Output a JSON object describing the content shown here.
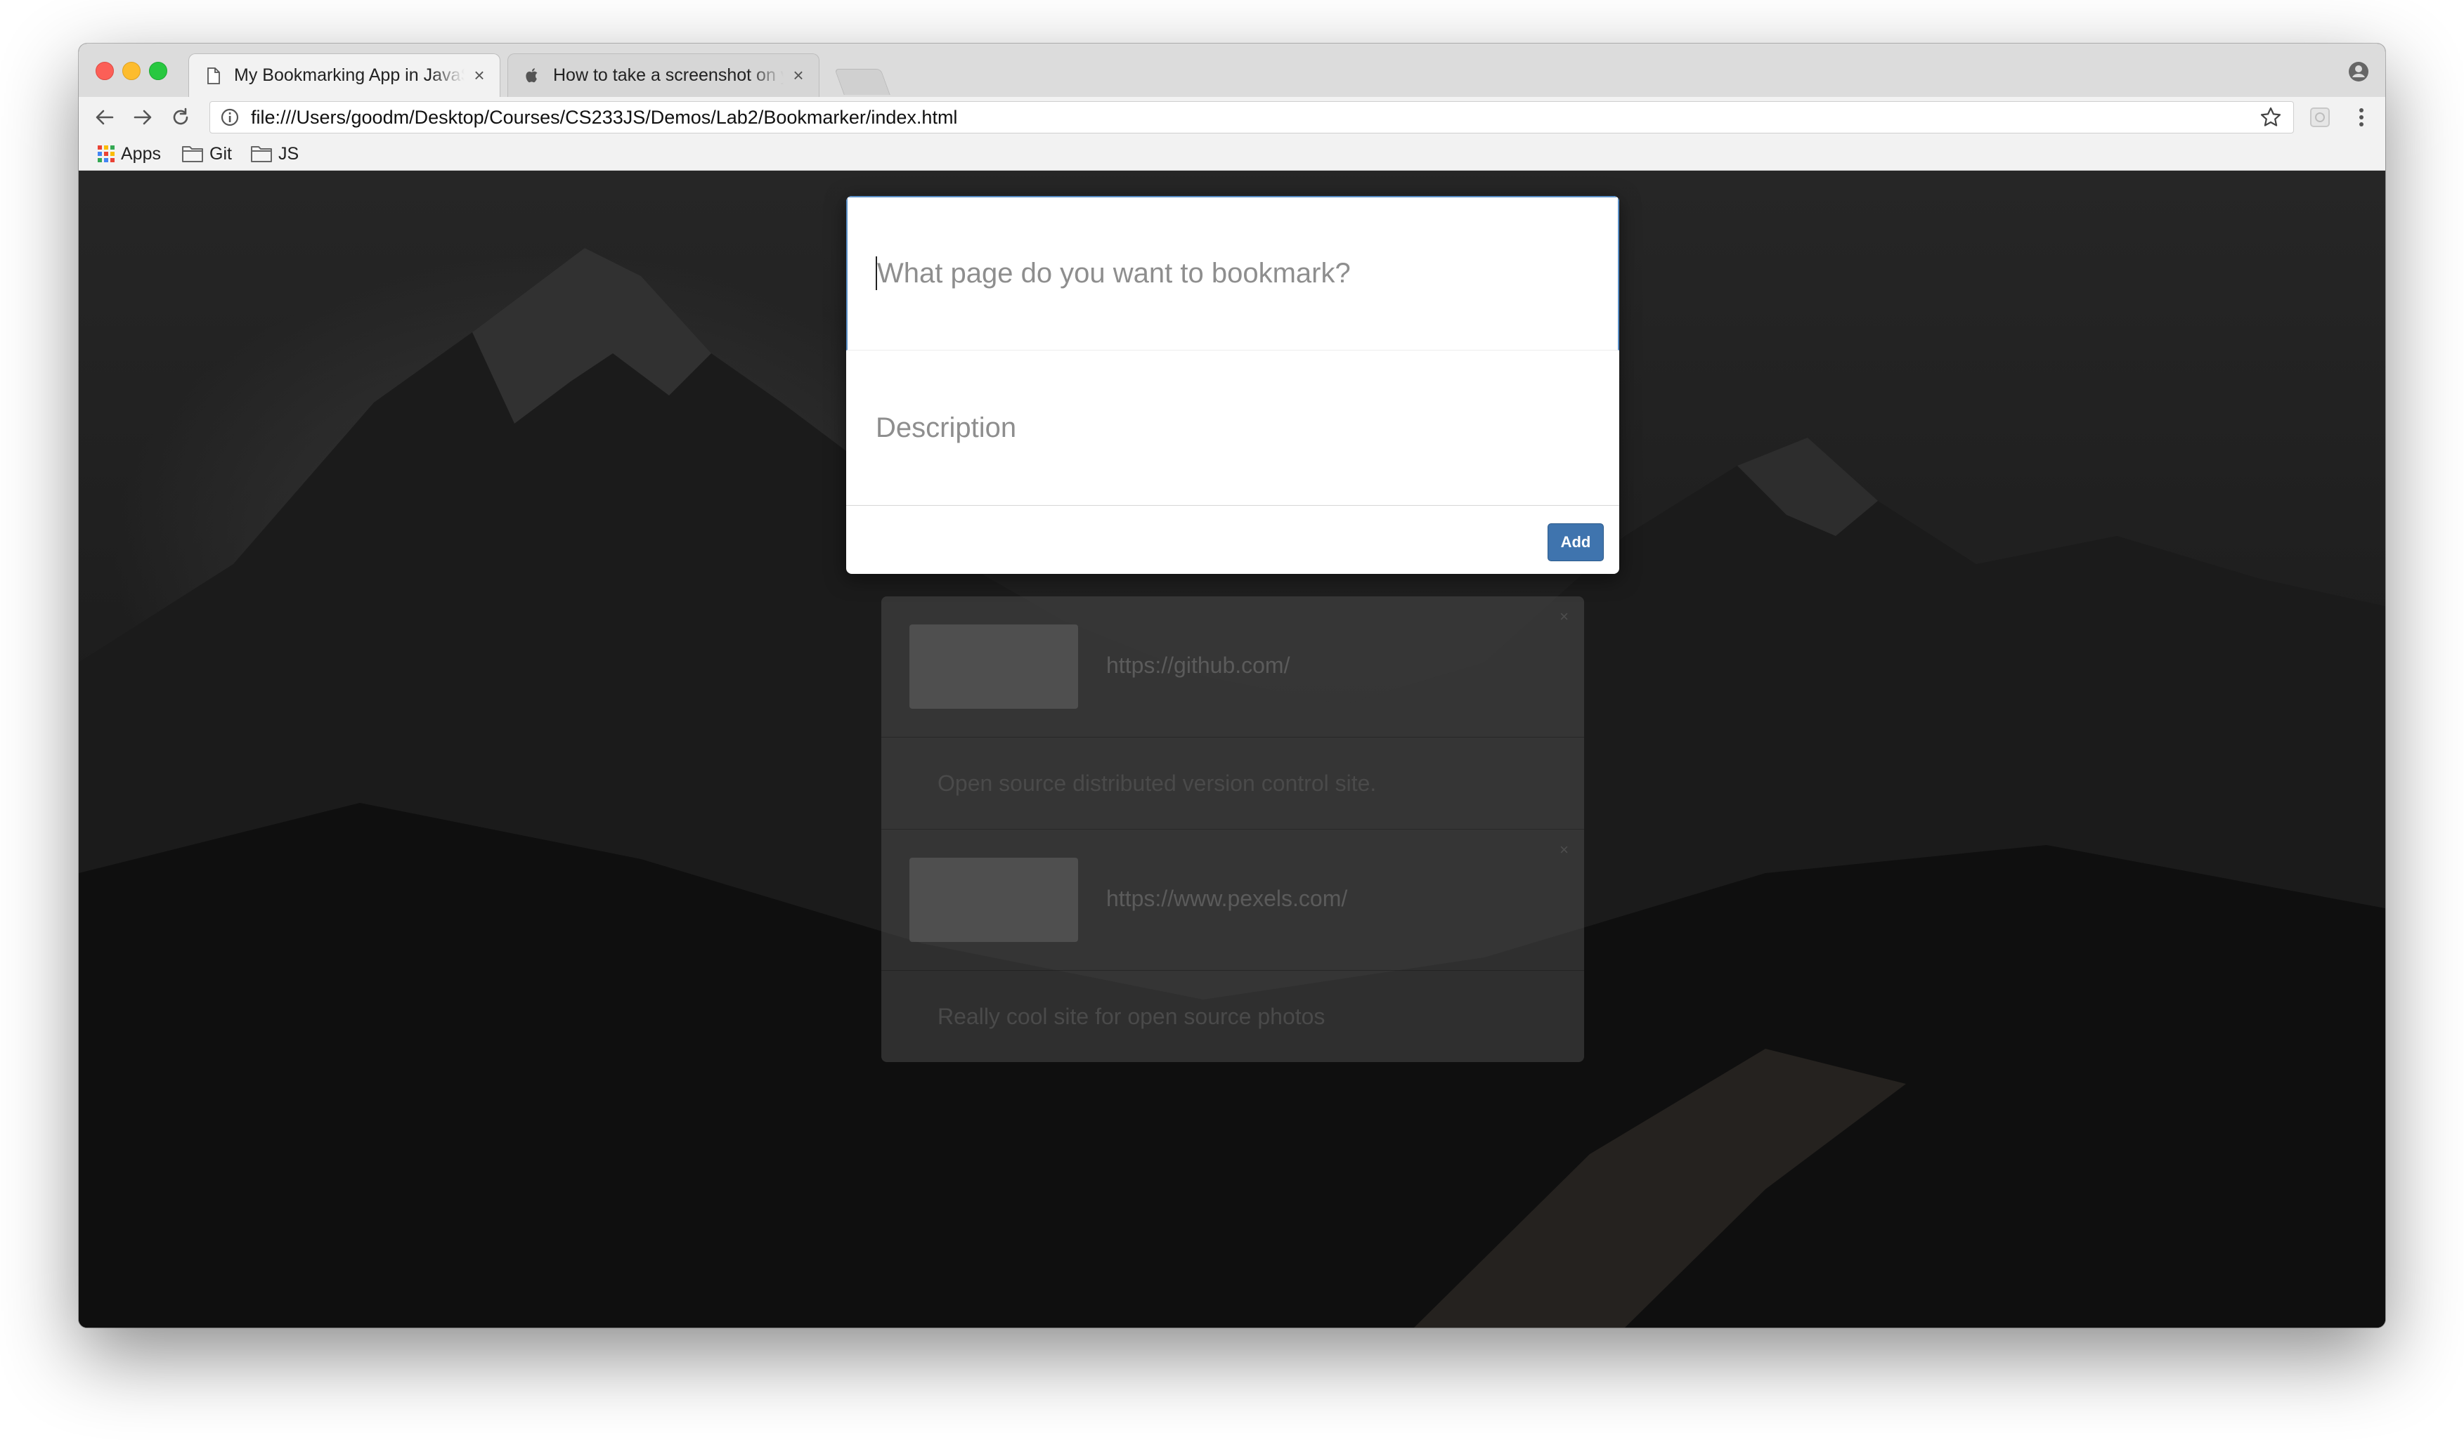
{
  "browser": {
    "tabs": [
      {
        "title": "My Bookmarking App in JavaScript",
        "close": "×"
      },
      {
        "title": "How to take a screenshot on your Mac",
        "close": "×"
      }
    ],
    "url": "file:///Users/goodm/Desktop/Courses/CS233JS/Demos/Lab2/Bookmarker/index.html",
    "bookmarks": [
      {
        "label": "Apps",
        "icon": "apps-grid-icon"
      },
      {
        "label": "Git",
        "icon": "folder-icon"
      },
      {
        "label": "JS",
        "icon": "folder-icon"
      }
    ]
  },
  "form": {
    "page_placeholder": "What page do you want to bookmark?",
    "description_placeholder": "Description",
    "add_label": "Add"
  },
  "bookmark_list": [
    {
      "url": "https://github.com/",
      "description": "Open source distributed version control site.",
      "remove": "×"
    },
    {
      "url": "https://www.pexels.com/",
      "description": "Really cool site for open source photos",
      "remove": "×"
    }
  ],
  "colors": {
    "add_button": "#3f74ae",
    "close_red": "#fc5f57",
    "minimize_yellow": "#fdbc2e",
    "zoom_green": "#28c840"
  }
}
